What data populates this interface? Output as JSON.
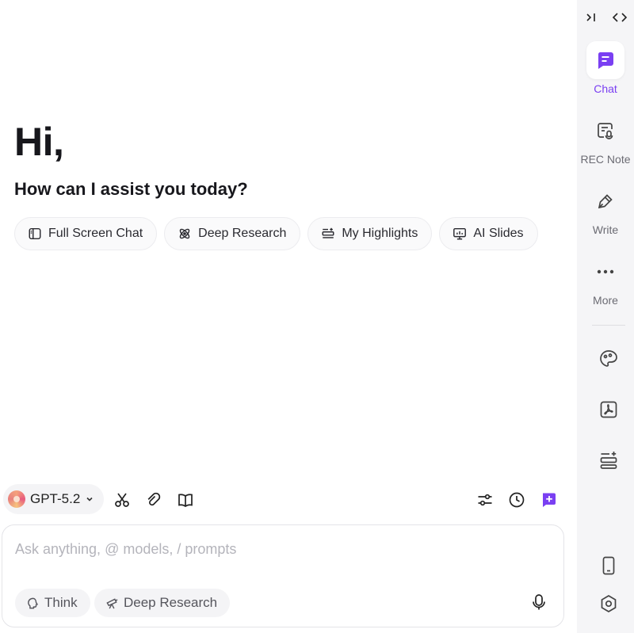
{
  "greeting": {
    "title": "Hi,",
    "subtitle": "How can I assist you today?"
  },
  "chips": [
    {
      "label": "Full Screen Chat",
      "icon": "sidebar-layout-icon"
    },
    {
      "label": "Deep Research",
      "icon": "atom-icon"
    },
    {
      "label": "My Highlights",
      "icon": "highlights-icon"
    },
    {
      "label": "AI Slides",
      "icon": "presentation-icon"
    }
  ],
  "toolbar": {
    "model_label": "GPT-5.2",
    "left_tools": [
      "scissors-icon",
      "paperclip-icon",
      "book-icon"
    ],
    "right_tools": [
      "sliders-icon",
      "clock-icon",
      "new-chat-icon"
    ]
  },
  "input": {
    "placeholder": "Ask anything, @ models, / prompts",
    "value": "",
    "think_label": "Think",
    "deep_research_label": "Deep Research"
  },
  "sidebar": {
    "items": [
      {
        "label": "Chat",
        "icon": "chat-icon",
        "active": true
      },
      {
        "label": "REC Note",
        "icon": "rec-note-icon",
        "active": false
      },
      {
        "label": "Write",
        "icon": "pen-icon",
        "active": false
      },
      {
        "label": "More",
        "icon": "more-icon",
        "active": false
      }
    ],
    "tools": [
      "palette-icon",
      "pdf-icon",
      "highlights-icon",
      "phone-icon",
      "settings-icon"
    ]
  },
  "colors": {
    "accent": "#7a3ff2",
    "sidebar_bg": "#f5f5f7",
    "chip_bg": "#fafafb"
  }
}
